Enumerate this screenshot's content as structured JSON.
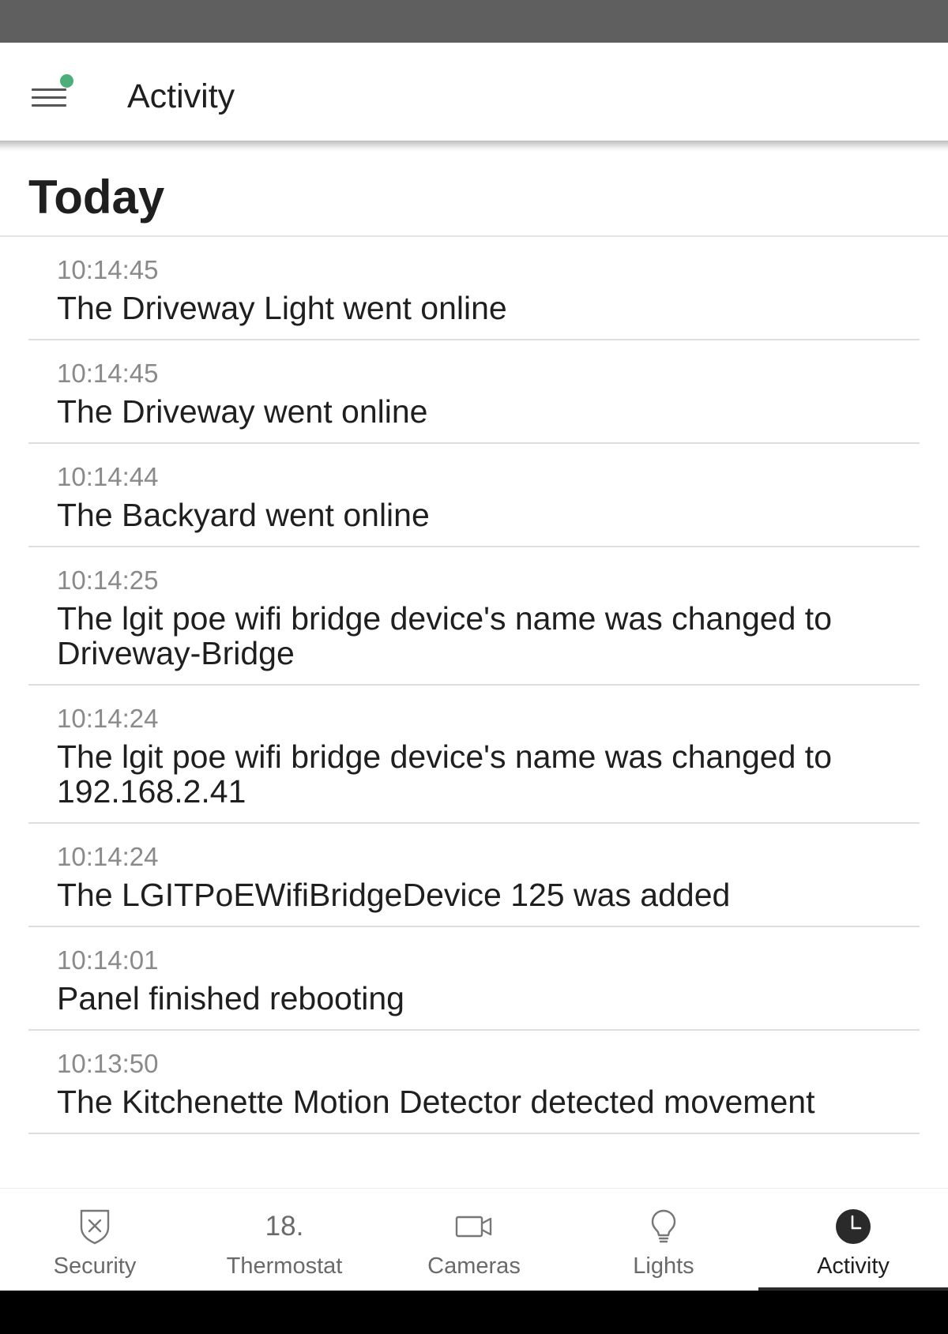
{
  "app_bar": {
    "title": "Activity",
    "notification_dot_color": "#4caf7a"
  },
  "section": {
    "label": "Today"
  },
  "activity": [
    {
      "time": "10:14:45",
      "message": "The Driveway Light went online"
    },
    {
      "time": "10:14:45",
      "message": "The Driveway went online"
    },
    {
      "time": "10:14:44",
      "message": "The Backyard went online"
    },
    {
      "time": "10:14:25",
      "message": "The lgit poe wifi bridge device's name was changed to Driveway-Bridge"
    },
    {
      "time": "10:14:24",
      "message": "The lgit poe wifi bridge device's name was changed to 192.168.2.41"
    },
    {
      "time": "10:14:24",
      "message": "The LGITPoEWifiBridgeDevice 125 was added"
    },
    {
      "time": "10:14:01",
      "message": "Panel finished rebooting"
    },
    {
      "time": "10:13:50",
      "message": "The Kitchenette Motion Detector detected movement"
    }
  ],
  "bottom_nav": {
    "items": [
      {
        "label": "Security",
        "icon": "shield-x-icon"
      },
      {
        "label": "Thermostat",
        "value": "18."
      },
      {
        "label": "Cameras",
        "icon": "video-camera-icon"
      },
      {
        "label": "Lights",
        "icon": "lightbulb-icon"
      },
      {
        "label": "Activity",
        "icon": "clock-icon",
        "active": true
      }
    ]
  }
}
